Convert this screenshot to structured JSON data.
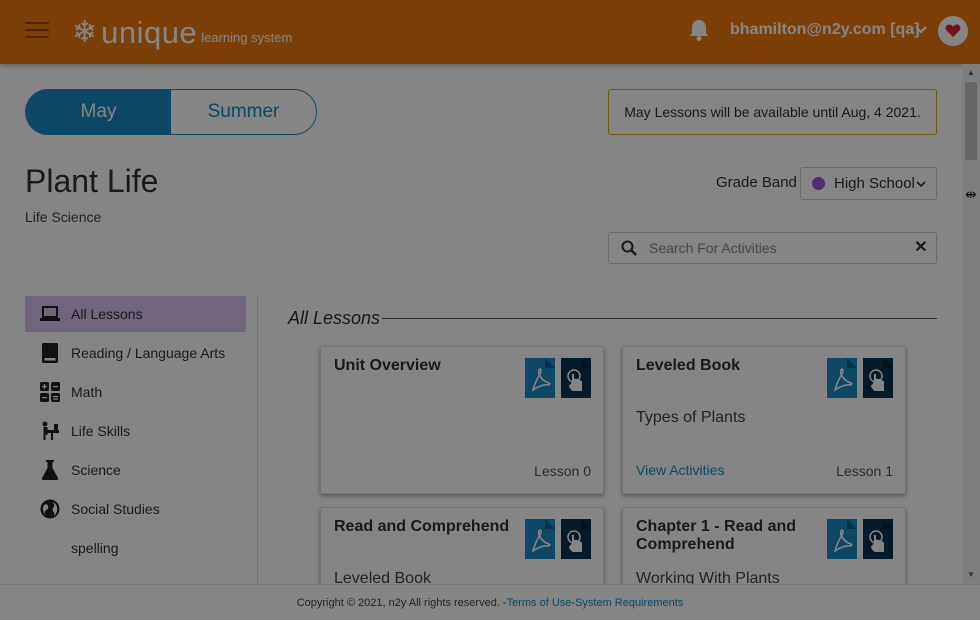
{
  "header": {
    "logo_main": "unique",
    "logo_sub": "learning system",
    "user": "bhamilton@n2y.com [qa]"
  },
  "toggle": {
    "options": [
      {
        "label": "May",
        "active": true
      },
      {
        "label": "Summer",
        "active": false
      }
    ]
  },
  "notice": "May Lessons will be available until Aug, 4 2021.",
  "page": {
    "title": "Plant Life",
    "subtitle": "Life Science"
  },
  "grade_band": {
    "label": "Grade Band",
    "value": "High School",
    "dot_color": "#9b59d8"
  },
  "search": {
    "placeholder": "Search For Activities"
  },
  "sidebar": {
    "items": [
      {
        "label": "All Lessons",
        "icon": "laptop-icon",
        "active": true
      },
      {
        "label": "Reading / Language Arts",
        "icon": "book-icon"
      },
      {
        "label": "Math",
        "icon": "calculator-icon"
      },
      {
        "label": "Life Skills",
        "icon": "person-at-desk-icon"
      },
      {
        "label": "Science",
        "icon": "flask-icon"
      },
      {
        "label": "Social Studies",
        "icon": "globe-icon"
      },
      {
        "label": "spelling",
        "icon": ""
      }
    ]
  },
  "section_title": "All Lessons",
  "cards": [
    {
      "title": "Unit Overview",
      "body": "",
      "link": "",
      "lesson": "Lesson 0"
    },
    {
      "title": "Leveled Book",
      "body": "Types of Plants",
      "link": "View Activities",
      "lesson": "Lesson 1"
    },
    {
      "title": "Read and Comprehend",
      "body": "Leveled Book",
      "link": "",
      "lesson": ""
    },
    {
      "title": "Chapter 1 - Read and Comprehend",
      "body": "Working With Plants",
      "link": "",
      "lesson": ""
    }
  ],
  "footer": {
    "copyright": "Copyright © 2021, n2y All rights reserved. - ",
    "terms": "Terms of Use",
    "sep": " - ",
    "requirements": "System Requirements"
  },
  "colors": {
    "header": "#f07a10",
    "accent": "#1b8ac6",
    "active_sidebar": "#d8c2f0",
    "notice_border": "#d9a520"
  }
}
